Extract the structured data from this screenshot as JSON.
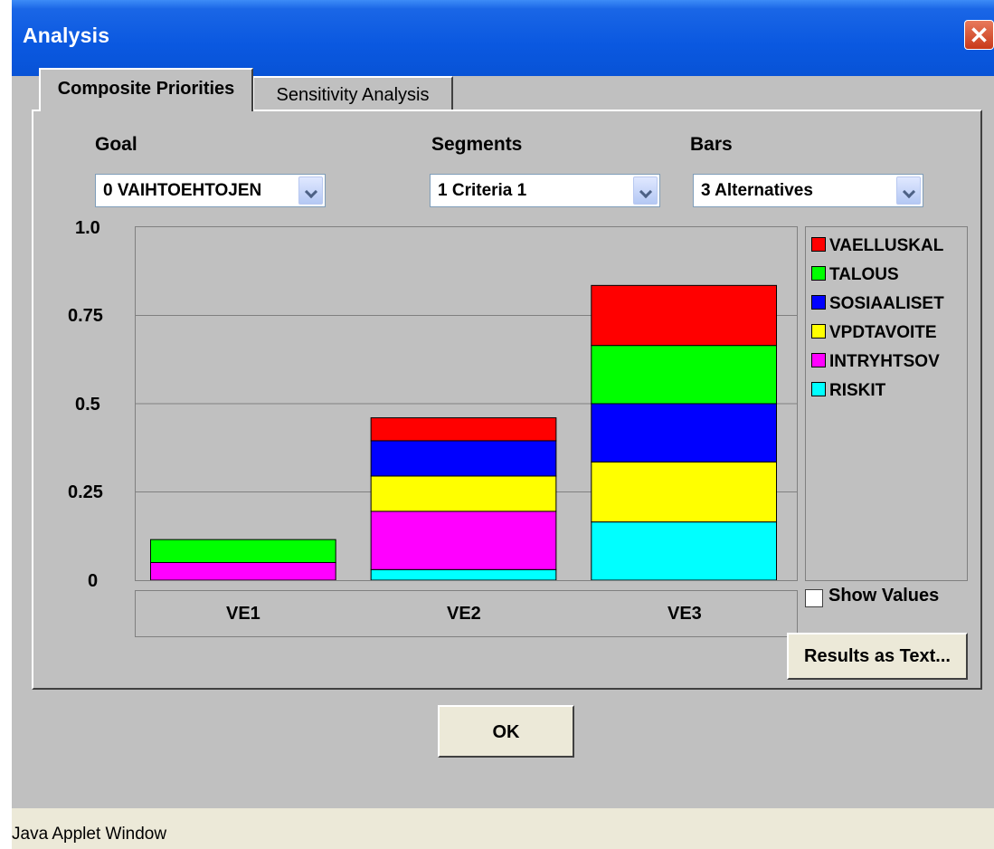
{
  "window": {
    "title": "Analysis"
  },
  "tabs": [
    {
      "label": "Composite Priorities",
      "active": true
    },
    {
      "label": "Sensitivity Analysis",
      "active": false
    }
  ],
  "controls": {
    "goal": {
      "label": "Goal",
      "value": "0 VAIHTOEHTOJEN"
    },
    "segments": {
      "label": "Segments",
      "value": "1 Criteria 1"
    },
    "bars": {
      "label": "Bars",
      "value": "3 Alternatives"
    }
  },
  "chart_data": {
    "type": "bar",
    "stacked": true,
    "ylim": [
      0,
      1.0
    ],
    "y_ticks": [
      "1.0",
      "0.75",
      "0.5",
      "0.25",
      "0"
    ],
    "y_tick_values": [
      1.0,
      0.75,
      0.5,
      0.25,
      0
    ],
    "categories": [
      "VE1",
      "VE2",
      "VE3"
    ],
    "series": [
      {
        "name": "RISKIT",
        "color": "#00ffff",
        "values": [
          0,
          0.03,
          0.165
        ]
      },
      {
        "name": "INTRYHTSOV",
        "color": "#ff00ff",
        "values": [
          0.05,
          0.165,
          0
        ]
      },
      {
        "name": "VPDTAVOITE",
        "color": "#ffff00",
        "values": [
          0,
          0.1,
          0.17
        ]
      },
      {
        "name": "SOSIAALISET",
        "color": "#0000ff",
        "values": [
          0,
          0.1,
          0.165
        ]
      },
      {
        "name": "TALOUS",
        "color": "#00ff00",
        "values": [
          0.065,
          0,
          0.165
        ]
      },
      {
        "name": "VAELLUSKAL",
        "color": "#ff0000",
        "values": [
          0,
          0.065,
          0.17
        ]
      }
    ],
    "legend_order": [
      "VAELLUSKAL",
      "TALOUS",
      "SOSIAALISET",
      "VPDTAVOITE",
      "INTRYHTSOV",
      "RISKIT"
    ],
    "grid": true,
    "legend_position": "right"
  },
  "show_values": {
    "label": "Show Values",
    "checked": false
  },
  "buttons": {
    "results": "Results as Text...",
    "ok": "OK"
  },
  "status": "Java Applet Window"
}
